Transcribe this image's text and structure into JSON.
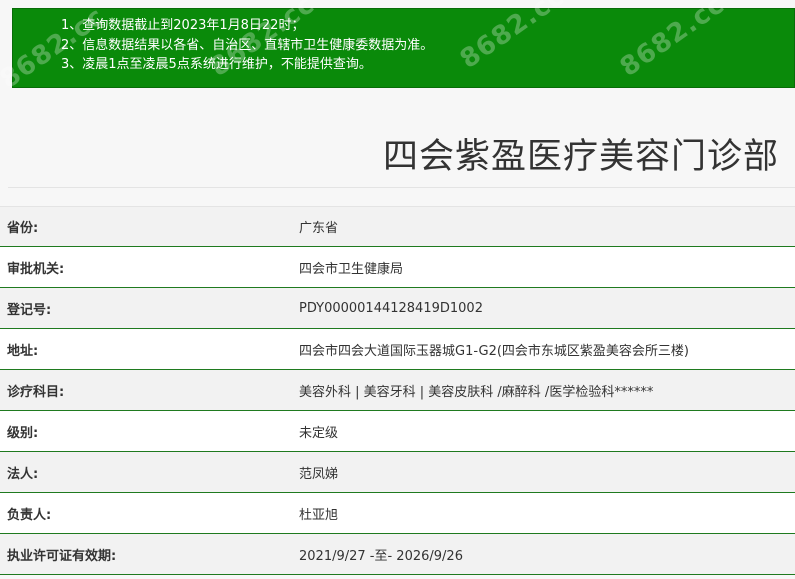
{
  "notice": {
    "lines": [
      "1、查询数据截止到2023年1月8日22时；",
      "2、信息数据结果以各省、自治区、直辖市卫生健康委数据为准。",
      "3、凌晨1点至凌晨5点系统进行维护，不能提供查询。"
    ],
    "background_color": "#0a8a0a"
  },
  "watermark_text": "8682.cc",
  "title": "四会紫盈医疗美容门诊部",
  "rows": [
    {
      "label": "省份:",
      "value": "广东省"
    },
    {
      "label": "审批机关:",
      "value": "四会市卫生健康局"
    },
    {
      "label": "登记号:",
      "value": "PDY00000144128419D1002"
    },
    {
      "label": "地址:",
      "value": "四会市四会大道国际玉器城G1-G2(四会市东城区紫盈美容会所三楼)"
    },
    {
      "label": "诊疗科目:",
      "value": "美容外科  |  美容牙科  |  美容皮肤科 /麻醉科 /医学检验科******"
    },
    {
      "label": "级别:",
      "value": "未定级"
    },
    {
      "label": "法人:",
      "value": "范凤娣"
    },
    {
      "label": "负责人:",
      "value": "杜亚旭"
    },
    {
      "label": "执业许可证有效期:",
      "value": "2021/9/27 -至- 2026/9/26"
    }
  ],
  "row_border_color": "#1f7a1f"
}
